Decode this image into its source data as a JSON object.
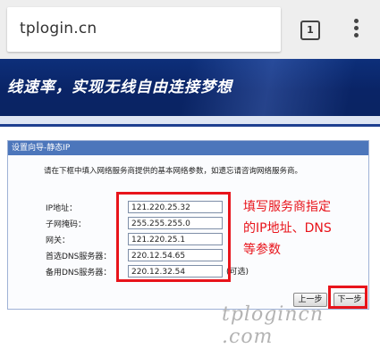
{
  "browser": {
    "url": "tplogin.cn",
    "tab_count": "1"
  },
  "banner": {
    "text": "线速率，实现无线自由连接梦想"
  },
  "panel": {
    "title": "设置向导-静态IP",
    "intro": "请在下框中填入网络服务商提供的基本网络参数，如遗忘请咨询网络服务商。",
    "fields": [
      {
        "label": "IP地址：",
        "value": "121.220.25.32"
      },
      {
        "label": "子网掩码：",
        "value": "255.255.255.0"
      },
      {
        "label": "网关：",
        "value": "121.220.25.1"
      },
      {
        "label": "首选DNS服务器：",
        "value": "220.12.54.65"
      },
      {
        "label": "备用DNS服务器：",
        "value": "220.12.32.54"
      }
    ],
    "optional_note": "(可选)",
    "prev_button": "上一步",
    "next_button": "下一步"
  },
  "annotation": {
    "lines": [
      "填写服务商指定",
      "的IP地址、DNS",
      "等参数"
    ]
  },
  "watermark": "tplogincn .com",
  "colors": {
    "annotation_red": "#e8141b",
    "banner_blue": "#0a2466",
    "panel_header": "#4c76bb"
  }
}
